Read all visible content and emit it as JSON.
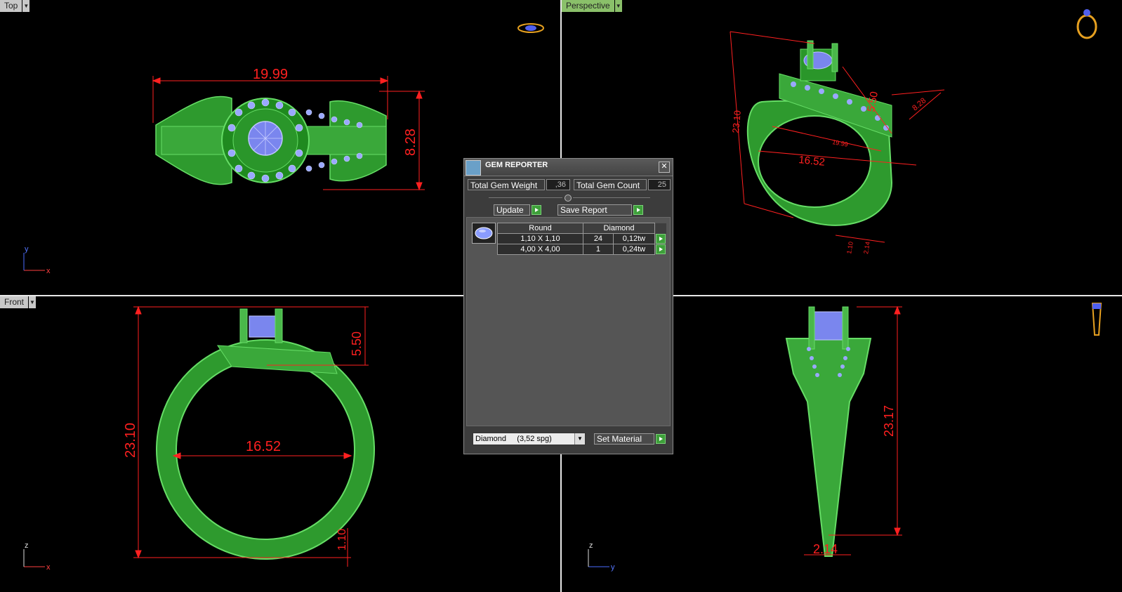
{
  "viewports": {
    "top": {
      "label": "Top",
      "dims": {
        "width": "19.99",
        "height": "8.28"
      },
      "axes": {
        "v": "y",
        "h": "x"
      }
    },
    "perspective": {
      "label": "Perspective",
      "dims": {
        "height": "23.10",
        "band": "16.52",
        "a": "5.50",
        "b": "8.28",
        "c": "19.99",
        "d": "1.10",
        "e": "2.14"
      }
    },
    "front": {
      "label": "Front",
      "dims": {
        "height": "23.10",
        "inner": "16.52",
        "head": "5.50",
        "shank": "1.10"
      },
      "axes": {
        "v": "z",
        "h": "x"
      }
    },
    "right": {
      "dims": {
        "height": "23.17",
        "width": "2.14"
      },
      "axes": {
        "v": "z",
        "h": "y"
      }
    }
  },
  "gem_reporter": {
    "title": "GEM REPORTER",
    "close": "✕",
    "total_weight_label": "Total Gem Weight",
    "total_weight": ",36",
    "total_count_label": "Total Gem Count",
    "total_count": "25",
    "update_label": "Update",
    "save_label": "Save Report",
    "table": {
      "shape": "Round",
      "material": "Diamond",
      "rows": [
        {
          "size": "1,10 X 1,10",
          "count": "24",
          "weight": "0,12tw"
        },
        {
          "size": "4,00 X 4,00",
          "count": "1",
          "weight": "0,24tw"
        }
      ]
    },
    "material_select": "Diamond     (3,52 spg)",
    "set_material_label": "Set Material"
  },
  "colors": {
    "wire": "#66dd66",
    "mesh": "#1a7a1a",
    "gem": "#8a9cff",
    "dim": "#ff2020",
    "bg": "#000000"
  }
}
